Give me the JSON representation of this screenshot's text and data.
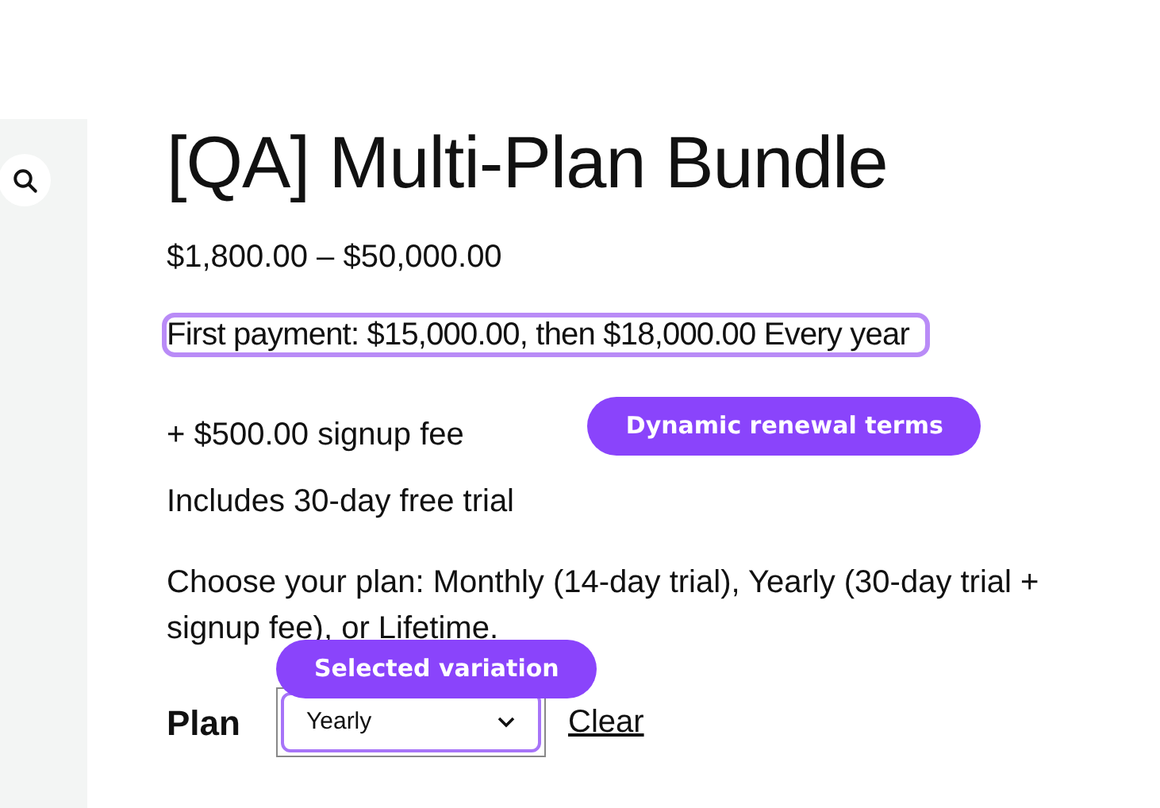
{
  "product": {
    "title": "[QA] Multi-Plan Bundle",
    "price_range": "$1,800.00 – $50,000.00",
    "first_payment": {
      "text": "First payment: $15,000.00, then $18,000.00 Every year",
      "highlighted": true,
      "annotation": "Dynamic renewal terms"
    },
    "signup_fee": "+ $500.00 signup fee",
    "trial": "Includes 30-day free trial",
    "description": "Choose your plan: Monthly (14-day trial), Yearly (30-day trial + signup fee), or Lifetime."
  },
  "variation": {
    "label": "Plan",
    "value": "Yearly",
    "highlighted": true,
    "annotation": "Selected variation",
    "clear": "Clear"
  }
}
